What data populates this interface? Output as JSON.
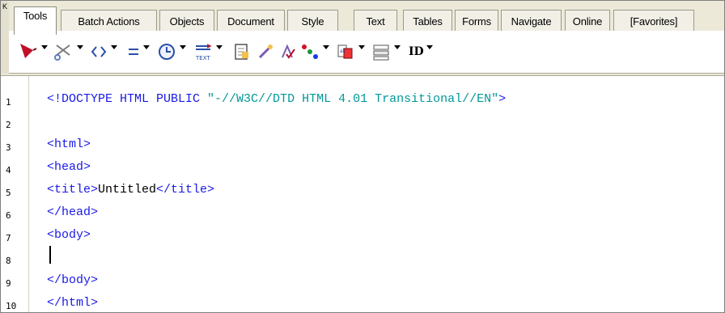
{
  "left_tab_label": "K",
  "tabs": [
    {
      "label": "Tools",
      "active": true
    },
    {
      "label": "Batch Actions"
    },
    {
      "label": "Objects"
    },
    {
      "label": "Document"
    },
    {
      "label": "Style"
    },
    {
      "label": "Text"
    },
    {
      "label": "Tables"
    },
    {
      "label": "Forms"
    },
    {
      "label": "Navigate"
    },
    {
      "label": "Online"
    },
    {
      "label": "[Favorites]"
    }
  ],
  "toolbar_icons": [
    {
      "name": "pen-tool-icon",
      "dropdown": true
    },
    {
      "name": "scissors-icon",
      "dropdown": true
    },
    {
      "name": "tag-brackets-icon",
      "dropdown": true
    },
    {
      "name": "equals-icon",
      "dropdown": true
    },
    {
      "name": "clock-icon",
      "dropdown": true
    },
    {
      "name": "text-layout-icon",
      "dropdown": true
    },
    {
      "name": "document-paste-icon"
    },
    {
      "name": "wand-icon"
    },
    {
      "name": "spell-check-icon"
    },
    {
      "name": "color-dots-icon",
      "dropdown": true
    },
    {
      "name": "copy-format-icon",
      "dropdown": true
    },
    {
      "name": "form-element-icon",
      "dropdown": true
    },
    {
      "name": "id-attribute-icon",
      "label": "ID",
      "dropdown": true
    }
  ],
  "editor": {
    "line_numbers": [
      "1",
      "2",
      "3",
      "4",
      "5",
      "6",
      "7",
      "8",
      "9",
      "10"
    ],
    "lines": {
      "l1_tag": "<!DOCTYPE HTML PUBLIC ",
      "l1_str": "\"-//W3C//DTD HTML 4.01 Transitional//EN\"",
      "l1_end": ">",
      "l3": "<html>",
      "l4": "<head>",
      "l5_open": "<title>",
      "l5_text": "Untitled",
      "l5_close": "</title>",
      "l6": "</head>",
      "l7": "<body>",
      "l9": "</body>",
      "l10": "</html>"
    }
  },
  "colors": {
    "tag": "#1a1ae6",
    "string": "#009999",
    "panel": "#ece9d8"
  }
}
